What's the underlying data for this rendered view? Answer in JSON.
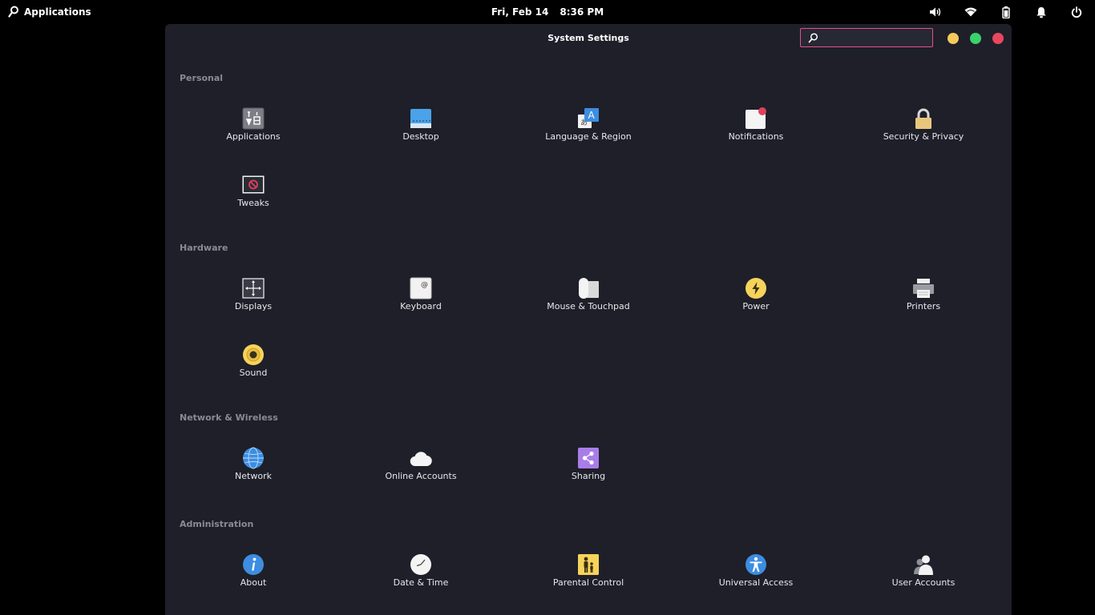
{
  "panel": {
    "applications_label": "Applications",
    "date": "Fri, Feb 14",
    "time": "8:36 PM",
    "indicators": [
      "volume-icon",
      "wifi-icon",
      "battery-icon",
      "notifications-icon",
      "power-icon"
    ]
  },
  "window": {
    "title": "System Settings",
    "search": {
      "value": "",
      "placeholder": ""
    },
    "buttons": {
      "minimize": "#f6c95b",
      "maximize": "#3bd16a",
      "close": "#e8475f"
    }
  },
  "colors": {
    "window_bg": "#1e1f29",
    "section_title": "#888b96",
    "search_border": "#e6508a"
  },
  "sections": [
    {
      "title": "Personal",
      "items": [
        {
          "label": "Applications",
          "icon": "applications-icon"
        },
        {
          "label": "Desktop",
          "icon": "desktop-icon"
        },
        {
          "label": "Language & Region",
          "icon": "language-icon"
        },
        {
          "label": "Notifications",
          "icon": "notifications-settings-icon"
        },
        {
          "label": "Security & Privacy",
          "icon": "lock-icon"
        },
        {
          "label": "Tweaks",
          "icon": "tweaks-icon"
        }
      ]
    },
    {
      "title": "Hardware",
      "items": [
        {
          "label": "Displays",
          "icon": "display-icon"
        },
        {
          "label": "Keyboard",
          "icon": "keyboard-icon"
        },
        {
          "label": "Mouse & Touchpad",
          "icon": "mouse-icon"
        },
        {
          "label": "Power",
          "icon": "power-settings-icon"
        },
        {
          "label": "Printers",
          "icon": "printer-icon"
        },
        {
          "label": "Sound",
          "icon": "speaker-icon"
        }
      ]
    },
    {
      "title": "Network & Wireless",
      "items": [
        {
          "label": "Network",
          "icon": "globe-icon"
        },
        {
          "label": "Online Accounts",
          "icon": "cloud-icon"
        },
        {
          "label": "Sharing",
          "icon": "share-icon"
        }
      ]
    },
    {
      "title": "Administration",
      "items": [
        {
          "label": "About",
          "icon": "info-icon"
        },
        {
          "label": "Date & Time",
          "icon": "clock-icon"
        },
        {
          "label": "Parental Control",
          "icon": "parental-control-icon"
        },
        {
          "label": "Universal Access",
          "icon": "accessibility-icon"
        },
        {
          "label": "User Accounts",
          "icon": "users-icon"
        }
      ]
    }
  ]
}
